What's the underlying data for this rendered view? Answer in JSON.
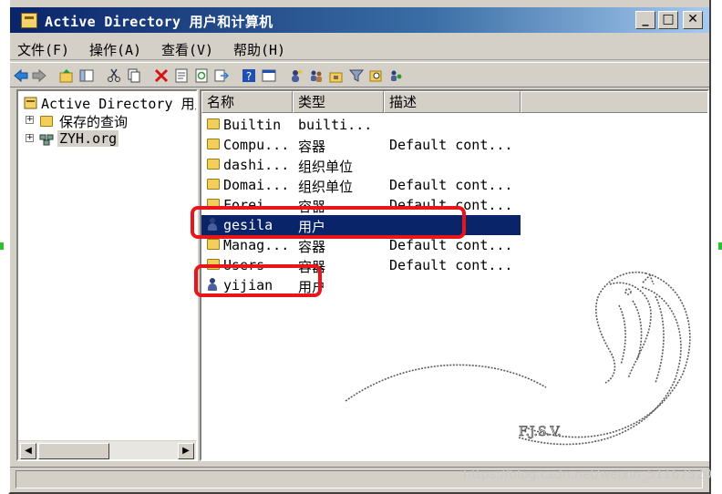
{
  "window": {
    "title": "Active Directory 用户和计算机",
    "minimize": "_",
    "maximize": "□",
    "close": "✕"
  },
  "menu": [
    "文件(F)",
    "操作(A)",
    "查看(V)",
    "帮助(H)"
  ],
  "toolbar_icons": [
    "back-icon",
    "forward-icon",
    "up-icon",
    "show-hide-tree-icon",
    "cut-icon",
    "copy-icon",
    "delete-icon",
    "properties-icon",
    "refresh-icon",
    "export-icon",
    "help-icon",
    "console-icon",
    "new-user-icon",
    "new-group-icon",
    "new-ou-icon",
    "filter-icon",
    "find-icon",
    "add-to-group-icon"
  ],
  "tree": {
    "root": "Active Directory 用户和计算机",
    "items": [
      {
        "label": "保存的查询"
      },
      {
        "label": "ZYH.org"
      }
    ]
  },
  "list": {
    "columns": [
      "名称",
      "类型",
      "描述"
    ],
    "rows": [
      {
        "name": "Builtin",
        "type": "builti...",
        "desc": "",
        "icon": "folder"
      },
      {
        "name": "Compu...",
        "type": "容器",
        "desc": "Default cont...",
        "icon": "folder"
      },
      {
        "name": "dashi...",
        "type": "组织单位",
        "desc": "",
        "icon": "folder"
      },
      {
        "name": "Domai...",
        "type": "组织单位",
        "desc": "Default cont...",
        "icon": "folder"
      },
      {
        "name": "Forei...",
        "type": "容器",
        "desc": "Default cont...",
        "icon": "folder"
      },
      {
        "name": "gesila",
        "type": "用户",
        "desc": "",
        "icon": "user",
        "selected": true
      },
      {
        "name": "Manag...",
        "type": "容器",
        "desc": "Default cont...",
        "icon": "folder"
      },
      {
        "name": "Users",
        "type": "容器",
        "desc": "Default cont...",
        "icon": "folder"
      },
      {
        "name": "yijian",
        "type": "用户",
        "desc": "",
        "icon": "user"
      }
    ]
  },
  "watermark": "https://blog.csdn.net/weixin_51167520",
  "logo_text": "F.J.S.V.",
  "colors": {
    "selection": "#0a246a",
    "highlight_box": "#e8161b",
    "titlebar": "#0a246a"
  }
}
